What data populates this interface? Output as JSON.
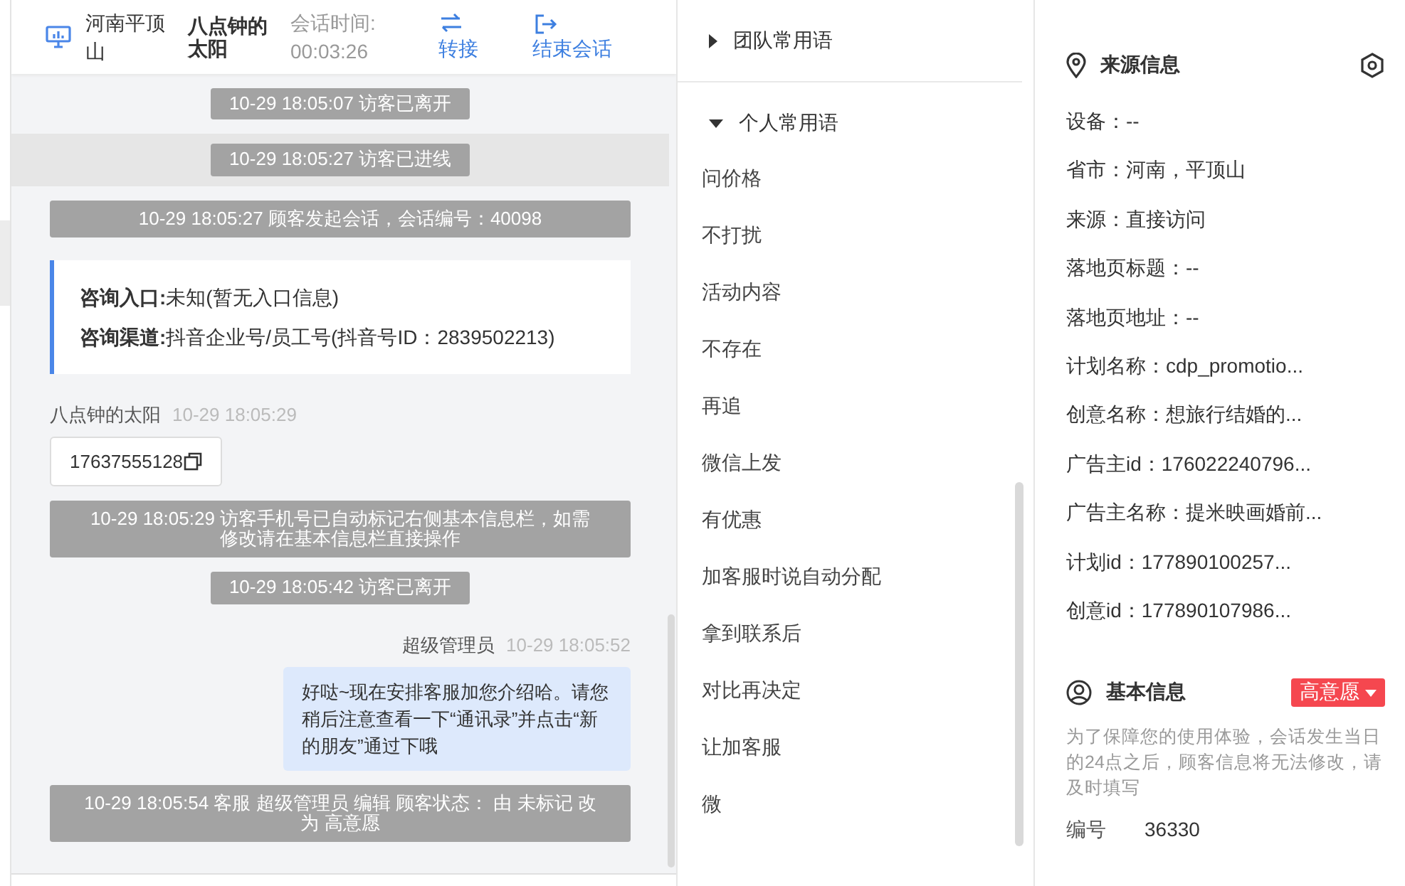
{
  "header": {
    "location": "河南平顶山",
    "visitor": "八点钟的太阳",
    "timer_label": "会话时间:",
    "timer": "00:03:26",
    "actions": [
      {
        "label": "转接",
        "kind": "transfer"
      },
      {
        "label": "结束会话",
        "kind": "end"
      }
    ]
  },
  "messages": [
    {
      "kind": "system",
      "text": "10-29 18:05:07 访客已离开",
      "highlighted": false
    },
    {
      "kind": "system",
      "text": "10-29 18:05:27 访客已进线",
      "highlighted": true
    },
    {
      "kind": "system",
      "text": "10-29 18:05:27 顾客发起会话，会话编号：40098",
      "highlighted": false
    },
    {
      "kind": "entry",
      "fields": [
        {
          "label": "咨询入口:",
          "value": "未知(暂无入口信息)"
        },
        {
          "label": "咨询渠道:",
          "value": "抖音企业号/员工号(抖音号ID：2839502213)"
        }
      ]
    },
    {
      "kind": "visitor",
      "sender": "八点钟的太阳",
      "time": "10-29 18:05:29",
      "text": "17637555128"
    },
    {
      "kind": "system",
      "text": "10-29 18:05:29 访客手机号已自动标记右侧基本信息栏，如需修改请在基本信息栏直接操作",
      "highlighted": false
    },
    {
      "kind": "system",
      "text": "10-29 18:05:42 访客已离开",
      "highlighted": false
    },
    {
      "kind": "agent",
      "sender": "超级管理员",
      "time": "10-29 18:05:52",
      "text": "好哒~现在安排客服加您介绍哈。请您稍后注意查看一下“通讯录”并点击“新的朋友”通过下哦"
    },
    {
      "kind": "system",
      "text": "10-29 18:05:54 客服 超级管理员 编辑 顾客状态： 由 未标记 改为 高意愿",
      "highlighted": false
    }
  ],
  "phrases": [
    {
      "title": "团队常用语",
      "expanded": false
    },
    {
      "title": "个人常用语",
      "expanded": true,
      "items": [
        "问价格",
        "不打扰",
        "活动内容",
        "不存在",
        "再追",
        "微信上发",
        "有优惠",
        "加客服时说自动分配",
        "拿到联系后",
        "对比再决定",
        "让加客服",
        "微"
      ]
    }
  ],
  "source_info": {
    "title": "来源信息",
    "fields": [
      "设备：--",
      "省市：河南，平顶山",
      "来源：直接访问",
      "落地页标题：--",
      "落地页地址：--",
      "计划名称：cdp_promotio...",
      "创意名称：想旅行结婚的...",
      "广告主id：176022240796...",
      "广告主名称：提米映画婚前...",
      "计划id：177890100257...",
      "创意id：177890107986..."
    ]
  },
  "basic_info": {
    "title": "基本信息",
    "tag": "高意愿",
    "note": "为了保障您的使用体验，会话发生当日的24点之后，顾客信息将无法修改，请及时填写",
    "fields": [
      {
        "label": "编号",
        "value": "36330"
      }
    ]
  }
}
